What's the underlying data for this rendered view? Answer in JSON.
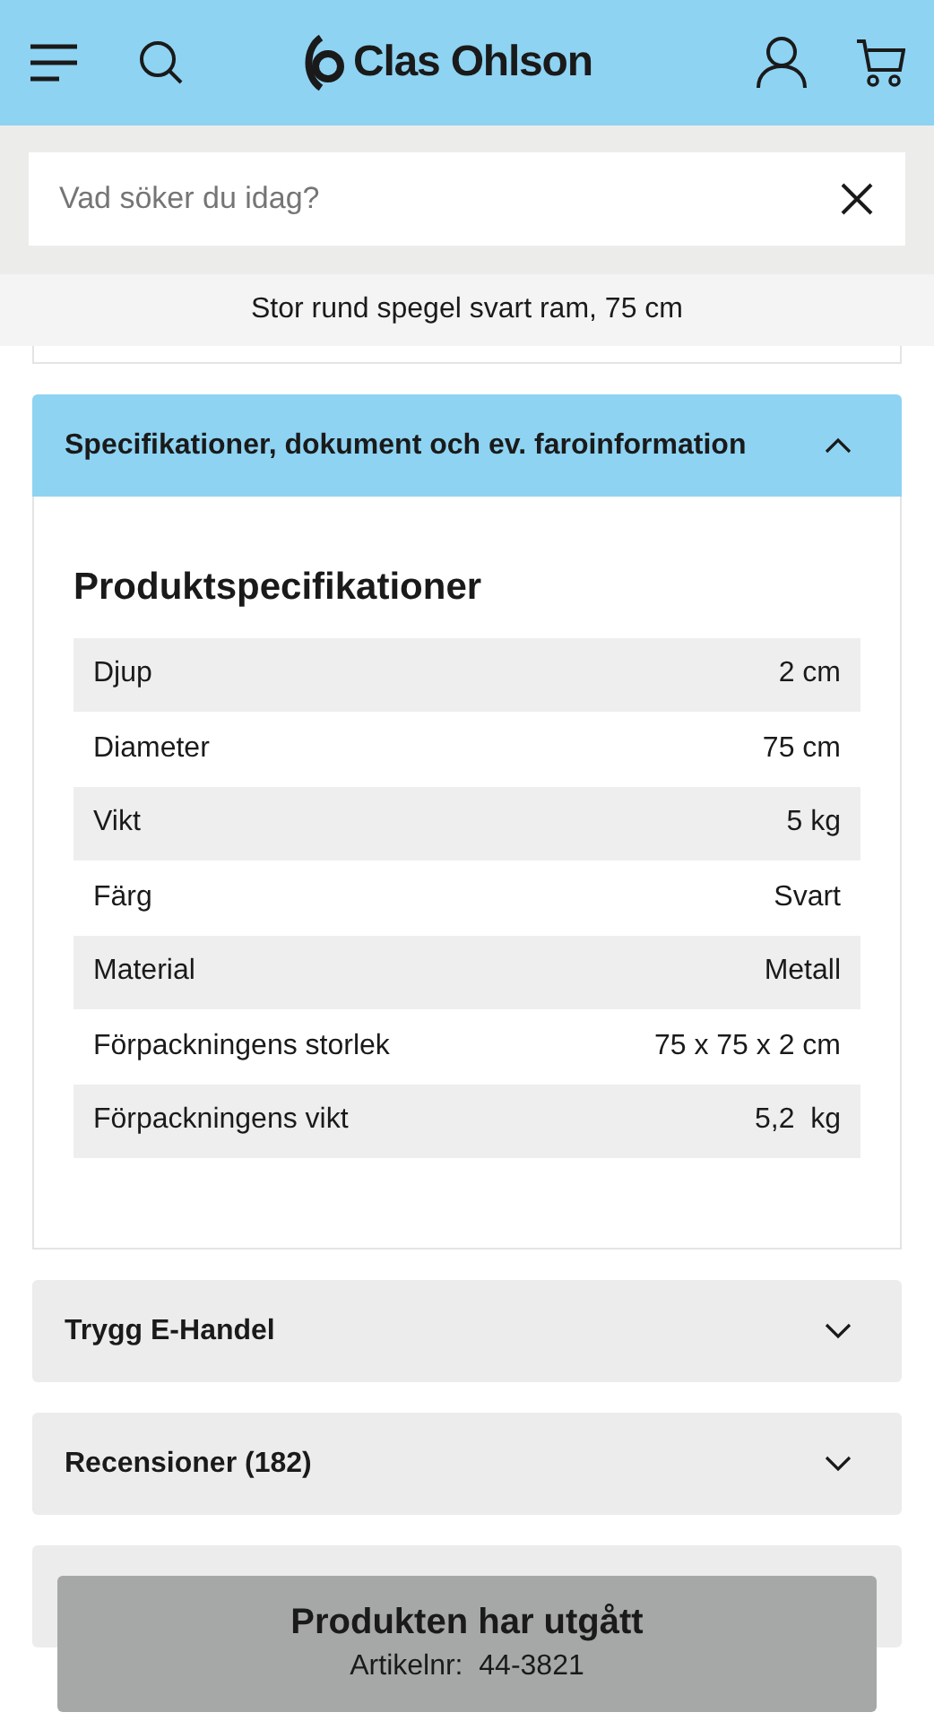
{
  "header": {
    "logo": "Clas Ohlson"
  },
  "search": {
    "placeholder": "Vad söker du idag?"
  },
  "product_title": "Stor rund spegel svart ram, 75 cm",
  "accordions": [
    {
      "title": "Specifikationer, dokument och ev. faroinformation",
      "expanded": true,
      "heading": "Produktspecifikationer",
      "rows": [
        {
          "label": "Djup",
          "value": "2 cm"
        },
        {
          "label": "Diameter",
          "value": "75 cm"
        },
        {
          "label": "Vikt",
          "value": "5 kg"
        },
        {
          "label": "Färg",
          "value": "Svart"
        },
        {
          "label": "Material",
          "value": "Metall"
        },
        {
          "label": "Förpackningens storlek",
          "value": "75 x 75 x 2 cm"
        },
        {
          "label": "Förpackningens vikt",
          "value": "5,2  kg"
        }
      ]
    },
    {
      "title": "Trygg E-Handel",
      "expanded": false
    },
    {
      "title": "Recensioner (182)",
      "expanded": false
    }
  ],
  "notice": {
    "title": "Produkten har utgått",
    "article_number": "Artikelnr:  44-3821"
  }
}
